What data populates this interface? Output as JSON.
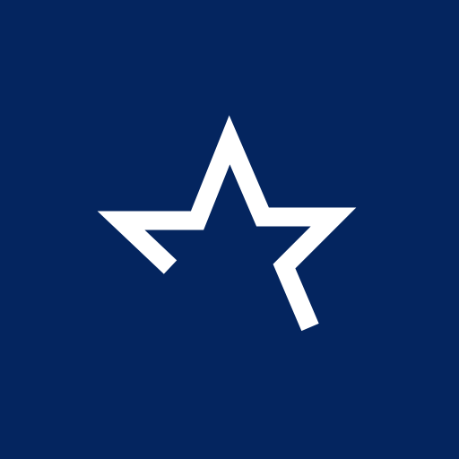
{
  "icon": {
    "name": "open-star-logo-icon",
    "background_color": "#04255F",
    "foreground_color": "#FFFFFF"
  }
}
